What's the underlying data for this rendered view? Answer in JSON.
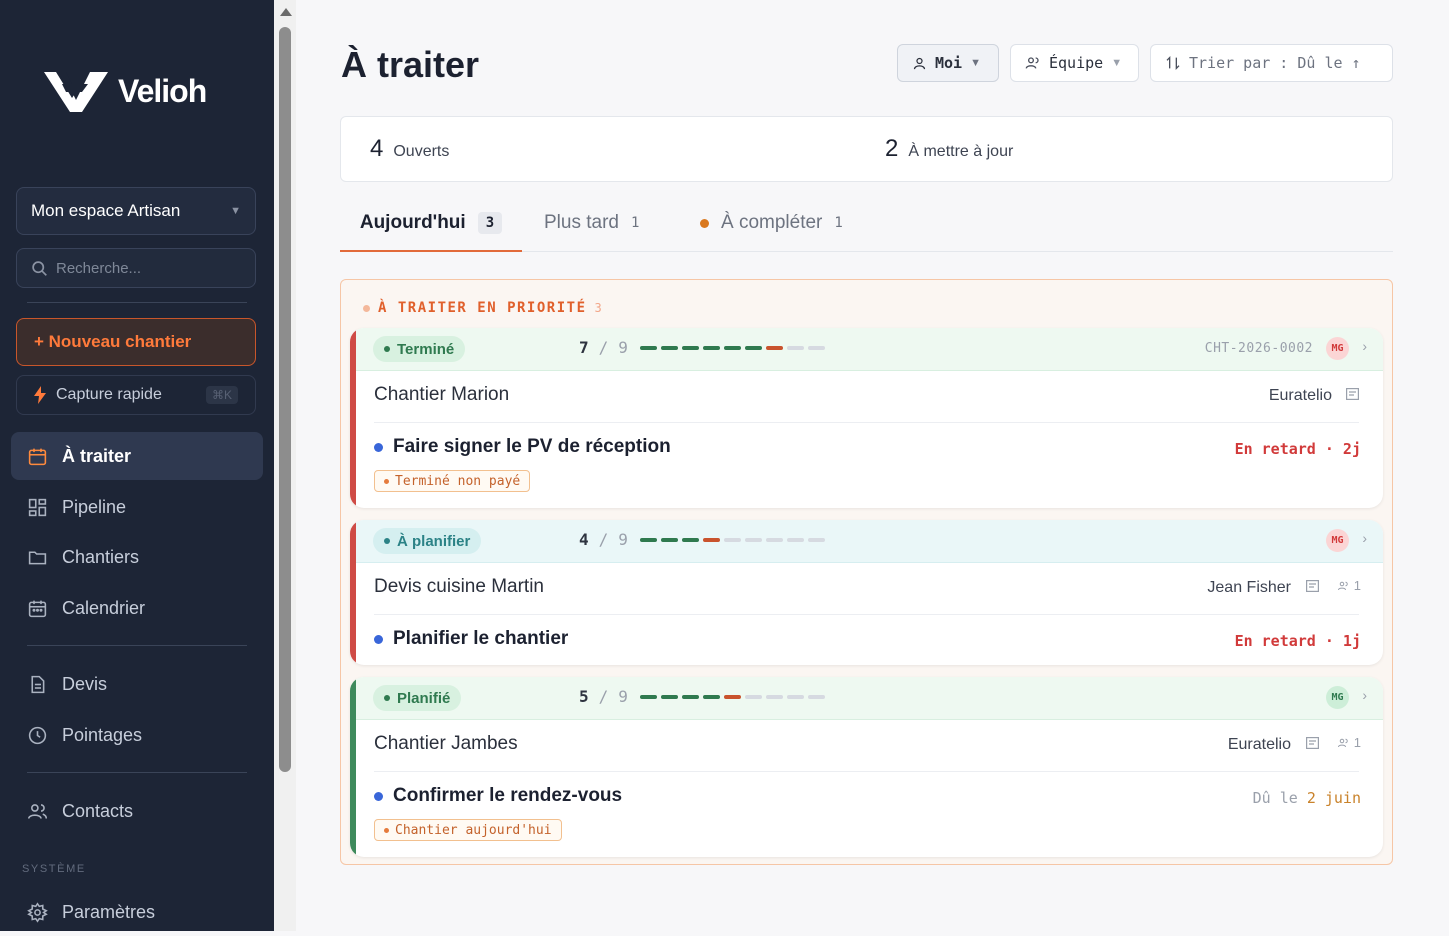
{
  "brand": {
    "name": "Velioh"
  },
  "sidebar": {
    "workspace": "Mon espace Artisan",
    "search_placeholder": "Recherche...",
    "new_project": "+ Nouveau chantier",
    "quick_capture": "Capture rapide",
    "quick_capture_shortcut": "⌘K",
    "items": [
      {
        "label": "À traiter",
        "icon": "calendar-icon",
        "active": true
      },
      {
        "label": "Pipeline",
        "icon": "grid-icon"
      },
      {
        "label": "Chantiers",
        "icon": "folder-icon"
      },
      {
        "label": "Calendrier",
        "icon": "calendar-icon"
      },
      {
        "label": "Devis",
        "icon": "document-icon"
      },
      {
        "label": "Pointages",
        "icon": "clock-icon"
      },
      {
        "label": "Contacts",
        "icon": "users-icon"
      }
    ],
    "section_system": "SYSTÈME",
    "settings": "Paramètres"
  },
  "header": {
    "title": "À traiter",
    "filter_me": "Moi",
    "filter_team": "Équipe",
    "sort": "Trier par : Dû le ↑"
  },
  "stats": {
    "open_count": "4",
    "open_label": "Ouverts",
    "update_count": "2",
    "update_label": "À mettre à jour"
  },
  "tabs": [
    {
      "label": "Aujourd'hui",
      "count": "3",
      "active": true
    },
    {
      "label": "Plus tard",
      "count": "1"
    },
    {
      "label": "À compléter",
      "count": "1"
    }
  ],
  "priority": {
    "title": "À TRAITER EN PRIORITÉ",
    "count": "3"
  },
  "cards": [
    {
      "status": "Terminé",
      "done": "7",
      "total": "9",
      "separator": "/",
      "ref": "CHT-2026-0002",
      "avatar": "MG",
      "title": "Chantier Marion",
      "client": "Euratelio",
      "assignees": "",
      "task": "Faire signer le PV de réception",
      "due": "En retard · 2j",
      "chip": "Terminé non payé"
    },
    {
      "status": "À planifier",
      "done": "4",
      "total": "9",
      "separator": "/",
      "ref": "",
      "avatar": "MG",
      "title": "Devis cuisine Martin",
      "client": "Jean Fisher",
      "assignees": "1",
      "task": "Planifier le chantier",
      "due": "En retard · 1j",
      "chip": ""
    },
    {
      "status": "Planifié",
      "done": "5",
      "total": "9",
      "separator": "/",
      "ref": "",
      "avatar": "MG",
      "title": "Chantier Jambes",
      "client": "Euratelio",
      "assignees": "1",
      "task": "Confirmer le rendez-vous",
      "due_prefix": "Dû le",
      "due_date": "2 juin",
      "chip": "Chantier aujourd'hui"
    }
  ],
  "colors": {
    "sidebar_bg": "#1d2536",
    "accent": "#e26a3a",
    "late": "#d13a3a",
    "bar_red": "#cf4b45",
    "bar_green": "#3e8a5c"
  }
}
